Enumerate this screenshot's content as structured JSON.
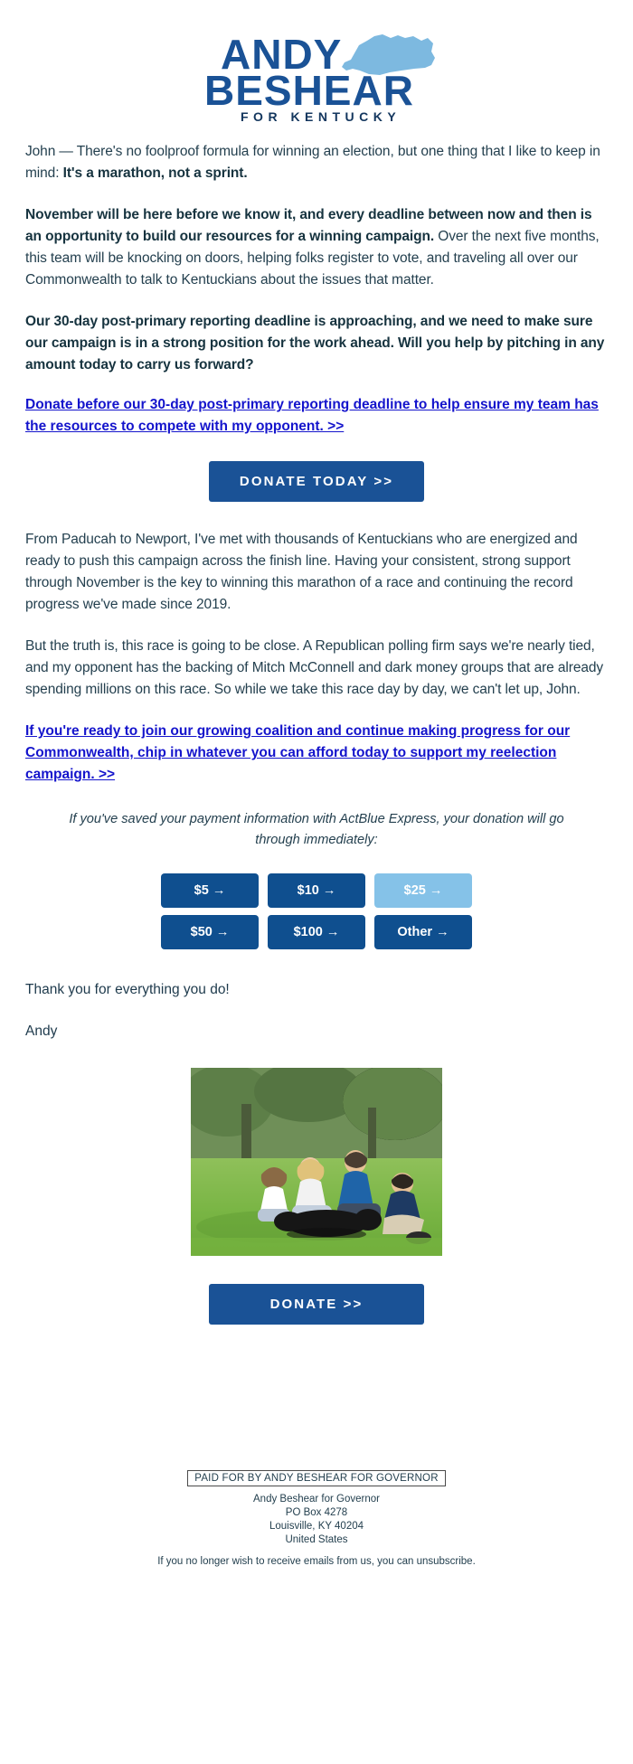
{
  "logo": {
    "line1": "ANDY",
    "line2": "BESHEAR",
    "line3": "FOR KENTUCKY",
    "map_alt": "kentucky-state-shape",
    "dark_blue": "#1a5296",
    "light_blue": "#7db9e0"
  },
  "body": {
    "p1_part1": "John — There's no foolproof formula for winning an election, but one thing that I like to keep in mind: ",
    "p1_bold": "It's a marathon, not a sprint.",
    "p2_bold": "November will be here before we know it, and every deadline between now and then is an opportunity to build our resources for a winning campaign.",
    "p2_rest": " Over the next five months, this team will be knocking on doors, helping folks register to vote, and traveling all over our Commonwealth to talk to Kentuckians about the issues that matter.",
    "p3_bold": "Our 30-day post-primary reporting deadline is approaching, and we need to make sure our campaign is in a strong position for the work ahead. Will you help by pitching in any amount today to carry us forward?",
    "p3_link": "Donate before our 30-day post-primary reporting deadline to help ensure my team has the resources to compete with my opponent. >>",
    "p4": "From Paducah to Newport, I've met with thousands of Kentuckians who are energized and ready to push this campaign across the finish line. Having your consistent, strong support through November is the key to winning this marathon of a race and continuing the record progress we've made since 2019.",
    "p5": "But the truth is, this race is going to be close. A Republican polling firm says we're nearly tied, and my opponent has the backing of Mitch McConnell and dark money groups that are already spending millions on this race. So while we take this race day by day, we can't let up, John.",
    "p6_link": "If you're ready to join our growing coalition and continue making progress for our Commonwealth, chip in whatever you can afford today to support my reelection campaign. >>",
    "thanks": "Thank you for everything you do!",
    "signature": "Andy"
  },
  "cta": {
    "primary_label": "DONATE TODAY >>",
    "secondary_label": "DONATE >>"
  },
  "express": {
    "note": "If you've saved your payment information with ActBlue Express, your donation will go through immediately:"
  },
  "amounts": [
    {
      "label": "$5 →",
      "highlight": false
    },
    {
      "label": "$10 →",
      "highlight": false
    },
    {
      "label": "$25 →",
      "highlight": true
    },
    {
      "label": "$50 →",
      "highlight": false
    },
    {
      "label": "$100 →",
      "highlight": false
    },
    {
      "label": "Other →",
      "highlight": false
    }
  ],
  "photo": {
    "alt": "family-with-dog-in-park-photo"
  },
  "footer": {
    "paid_for": "PAID FOR BY ANDY BESHEAR FOR GOVERNOR",
    "org": "Andy Beshear for Governor",
    "po_box": "PO Box 4278",
    "city_state_zip": "Louisville, KY 40204",
    "country": "United States",
    "unsub_pre": "If you no longer wish to receive emails from us, you can ",
    "unsub_link": "unsubscribe",
    "unsub_post": "."
  }
}
